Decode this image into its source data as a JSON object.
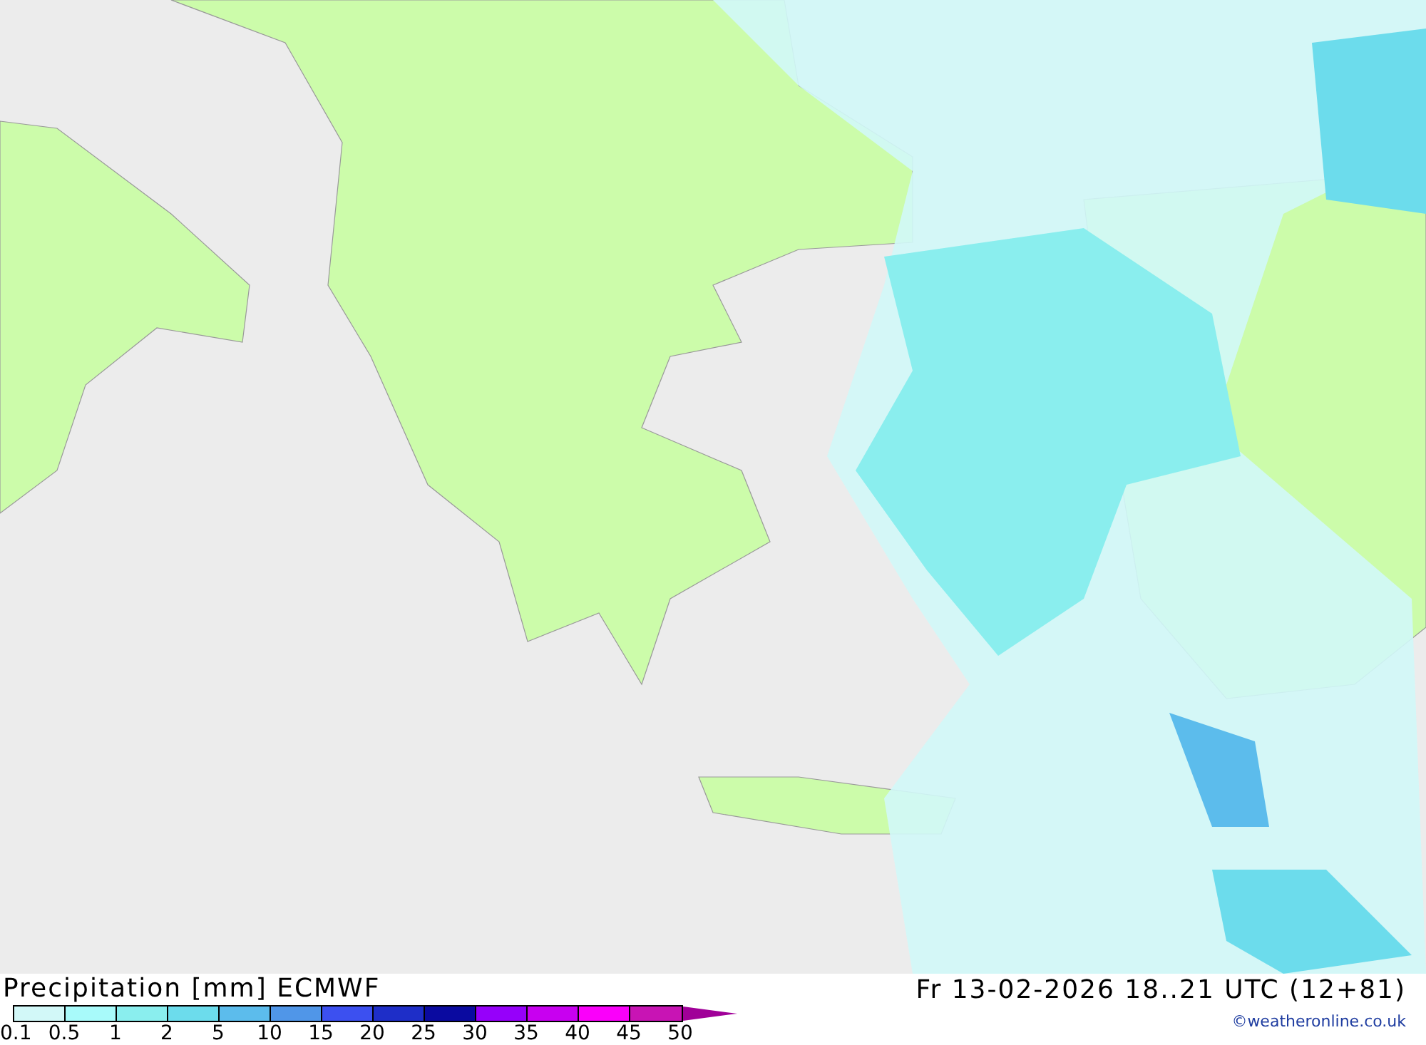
{
  "legend": {
    "title": "Precipitation [mm] ECMWF",
    "bins": [
      {
        "kind": "box",
        "color": "#d2f8f8"
      },
      {
        "kind": "box",
        "color": "#a8fafa"
      },
      {
        "kind": "box",
        "color": "#8aeeee"
      },
      {
        "kind": "box",
        "color": "#6cdcec"
      },
      {
        "kind": "box",
        "color": "#5cbcec"
      },
      {
        "kind": "box",
        "color": "#5096e8"
      },
      {
        "kind": "box",
        "color": "#3c50f0"
      },
      {
        "kind": "box",
        "color": "#1e2ec8"
      },
      {
        "kind": "box",
        "color": "#0a0aa0"
      },
      {
        "kind": "box",
        "color": "#9600fa"
      },
      {
        "kind": "box",
        "color": "#c800f0"
      },
      {
        "kind": "box",
        "color": "#fa00fa"
      },
      {
        "kind": "box",
        "color": "#c814b4"
      },
      {
        "kind": "arrow",
        "color": "#a00098"
      }
    ],
    "labels": [
      "0.1",
      "0.5",
      "1",
      "2",
      "5",
      "10",
      "15",
      "20",
      "25",
      "30",
      "35",
      "40",
      "45",
      "50"
    ]
  },
  "valid_time": "Fr 13-02-2026 18..21 UTC (12+81)",
  "credit": "©weatheronline.co.uk"
}
